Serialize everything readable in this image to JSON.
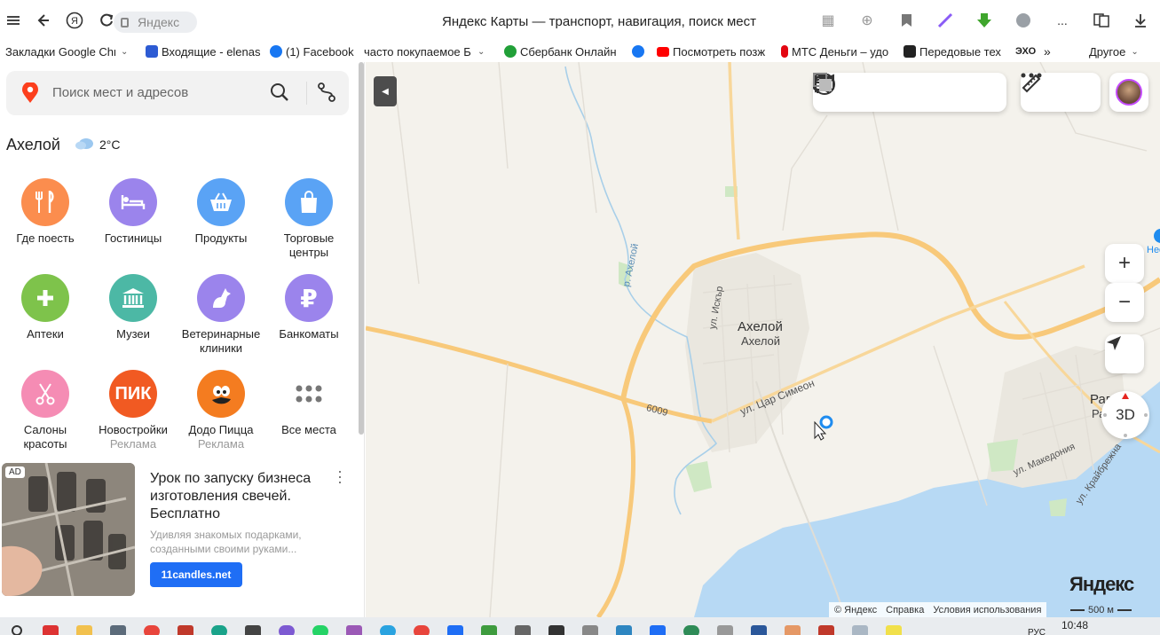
{
  "browser": {
    "url_text": "Яндекс",
    "page_title": "Яндекс Карты — транспорт, навигация, поиск мест",
    "menu_label": "..."
  },
  "bookmarks": [
    {
      "label": "Закладки Google Chr",
      "icon": "folder-icon",
      "color": "#ffffff"
    },
    {
      "label": "Входящие - elenas",
      "icon": "mail-icon",
      "color": "#2d5bd3"
    },
    {
      "label": "(1) Facebook",
      "icon": "facebook-icon",
      "color": "#1877f2"
    },
    {
      "label": "часто покупаемое Б",
      "icon": "folder-icon",
      "color": "#ffffff"
    },
    {
      "label": "Сбербанк Онлайн",
      "icon": "sber-icon",
      "color": "#21a038"
    },
    {
      "label": "",
      "icon": "facebook-icon",
      "color": "#1877f2"
    },
    {
      "label": "Посмотреть позж",
      "icon": "youtube-icon",
      "color": "#ff0000"
    },
    {
      "label": "МТС Деньги – удо",
      "icon": "mts-icon",
      "color": "#e30611"
    },
    {
      "label": "Передовые тех",
      "icon": "r-icon",
      "color": "#222222"
    },
    {
      "label": "ЭХО",
      "icon": "echo-icon",
      "color": "#ffffff"
    }
  ],
  "bookmarks_other": "Другое",
  "sidebar": {
    "search_placeholder": "Поиск мест и адресов",
    "city": "Ахелой",
    "temperature": "2°C",
    "categories": [
      {
        "label": "Где поесть",
        "sub": "",
        "icon": "fork-knife-icon",
        "color": "#fb8d4e"
      },
      {
        "label": "Гостиницы",
        "sub": "",
        "icon": "bed-icon",
        "color": "#9b84ec"
      },
      {
        "label": "Продукты",
        "sub": "",
        "icon": "basket-icon",
        "color": "#5aa3f5"
      },
      {
        "label": "Торговые центры",
        "sub": "",
        "icon": "shopping-bag-icon",
        "color": "#5aa3f5"
      },
      {
        "label": "Аптеки",
        "sub": "",
        "icon": "plus-icon",
        "color": "#7ec34b"
      },
      {
        "label": "Музеи",
        "sub": "",
        "icon": "museum-icon",
        "color": "#4cb8a5"
      },
      {
        "label": "Ветеринарные клиники",
        "sub": "",
        "icon": "pet-icon",
        "color": "#9b84ec"
      },
      {
        "label": "Банкоматы",
        "sub": "",
        "icon": "ruble-icon",
        "color": "#9b84ec"
      },
      {
        "label": "Салоны красоты",
        "sub": "",
        "icon": "scissors-icon",
        "color": "#f58cb4"
      },
      {
        "label": "Новостройки",
        "sub": "Реклама",
        "icon": "pik-logo-icon",
        "color": "#f15a22",
        "logo_text": "ПИК"
      },
      {
        "label": "Додо Пицца",
        "sub": "Реклама",
        "icon": "dodo-logo-icon",
        "color": "#f47c20"
      },
      {
        "label": "Все места",
        "sub": "",
        "icon": "grid-dots-icon",
        "color": "#ffffff"
      }
    ],
    "ad": {
      "tag": "AD",
      "title": "Урок по запуску бизнеса изготовления свечей. Бесплатно",
      "description": "Удивляя знакомых подарками, созданными своими руками...",
      "button": "11candles.net"
    }
  },
  "map": {
    "labels": {
      "town": "Ахелой",
      "town_sub": "Ахелой",
      "street_iskar": "ул. Искър",
      "street_simeon": "ул. Цар Симеон",
      "road_6009": "6009",
      "river": "р. Ахелой",
      "town_east": "Рав",
      "town_east_sub": "Рав",
      "street_makedonia": "ул. Македония",
      "street_kraibrezhna": "ул. Крайбрежна",
      "partial_label": "Нес"
    },
    "controls": {
      "zoom_in": "+",
      "zoom_out": "−",
      "view_3d": "3D"
    },
    "logo": "Яндекс",
    "footer": [
      "© Яндекс",
      "Справка",
      "Условия использования"
    ],
    "scale": "500 м"
  },
  "taskbar": {
    "lang": "РУС",
    "time": "10:48"
  }
}
